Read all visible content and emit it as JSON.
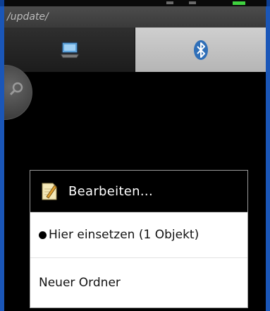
{
  "path_bar": {
    "text": "/update/"
  },
  "tabs": [
    {
      "icon": "device-storage-icon"
    },
    {
      "icon": "bluetooth-icon"
    }
  ],
  "dialog": {
    "title": "Bearbeiten...",
    "icon": "note-edit-icon",
    "items": [
      {
        "label": "Hier einsetzen (1 Objekt)"
      },
      {
        "label": "Neuer Ordner"
      }
    ]
  },
  "colors": {
    "frame": "#1a56b8",
    "status_battery": "#3fd23f",
    "screen_bg": "#000000",
    "dialog_bg": "#ffffff",
    "bluetooth_blue": "#2f6fb8"
  }
}
